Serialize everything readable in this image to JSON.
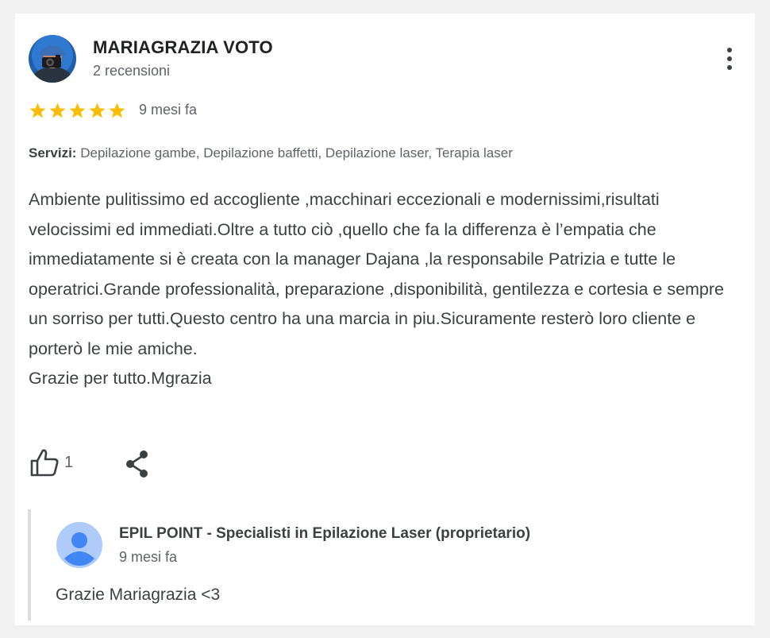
{
  "review": {
    "reviewer_name": "MARIAGRAZIA VOTO",
    "review_count": "2 recensioni",
    "rating": 5,
    "rating_max": 5,
    "time": "9 mesi fa",
    "services_label": "Servizi:",
    "services": "Depilazione gambe, Depilazione baffetti, Depilazione laser, Terapia laser",
    "text_main": "Ambiente pulitissimo ed accogliente ,macchinari eccezionali e modernissimi,risultati velocissimi ed immediati.Oltre a tutto ciò ,quello che fa la differenza è l’empatia che immediatamente si è creata con la manager Dajana ,la responsabile Patrizia e tutte le operatrici.Grande professionalità, preparazione ,disponibilità, gentilezza e cortesia e sempre un sorriso per tutti.Questo centro ha una marcia in piu.Sicuramente resterò loro cliente e porterò le mie amiche.",
    "text_signoff": "Grazie per tutto.Mgrazia",
    "like_count": "1",
    "icons": {
      "more": "more-vert-icon",
      "like": "thumb-up-icon",
      "share": "share-icon",
      "star": "star-icon"
    },
    "colors": {
      "star": "#fbbc04",
      "avatar_bg": "#1a73e8"
    }
  },
  "owner_reply": {
    "name": "EPIL POINT - Specialisti in Epilazione Laser (proprietario)",
    "time": "9 mesi fa",
    "text": "Grazie Mariagrazia <3",
    "avatar_icon": "person-icon",
    "colors": {
      "avatar_bg": "#aecbfa",
      "avatar_fg": "#4285f4"
    }
  }
}
